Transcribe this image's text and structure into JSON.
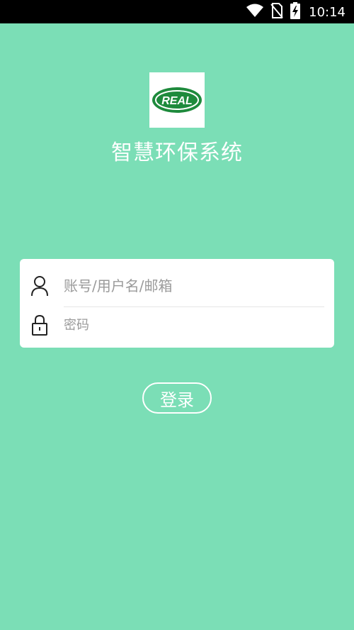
{
  "status_bar": {
    "time": "10:14",
    "icons": [
      "wifi-icon",
      "no-sim-icon",
      "battery-charging-icon"
    ]
  },
  "logo": {
    "text": "REAL",
    "colors": {
      "green": "#1e8a3c",
      "white": "#ffffff"
    }
  },
  "app": {
    "title": "智慧环保系统"
  },
  "login": {
    "username_placeholder": "账号/用户名/邮箱",
    "password_placeholder": "密码",
    "button_label": "登录"
  },
  "colors": {
    "background": "#7bdeb6",
    "card": "#ffffff",
    "status_bar": "#000000"
  }
}
